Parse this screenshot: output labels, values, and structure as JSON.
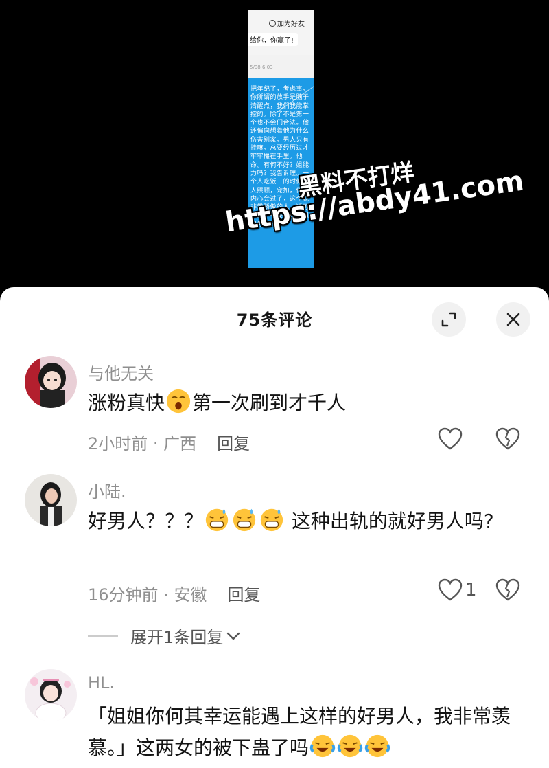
{
  "video": {
    "screenshot": {
      "add_friend": "加为好友",
      "message_top": "给你，你赢了!",
      "time": "5/08 6:03",
      "bubble_text": "把年纪了，考虑事。你所谓的放手是脑子清醒点，我们我能掌控的。除了不是第一个也不会们合法。他还偏向想着他为什么伤害别家。男人只有挂嘛。总要经历过才牢牢攥在手里。他命。有何不好？姐能力吗？我告诉理。一个人吃饭一的时候没人照顾，宠如，你的内心会过了，这个就非常骄傲的人，适可而止。不要追他。姐姐你何其"
    },
    "watermark": {
      "line1": "黑料不打烊",
      "line2": "https://abdy41.com"
    }
  },
  "header": {
    "title": "75条评论"
  },
  "comments": [
    {
      "author": "与他无关",
      "text_before": "涨粉真快",
      "text_after": "第一次刷到才千人",
      "time": "2小时前",
      "location": "广西",
      "reply_label": "回复",
      "likes": ""
    },
    {
      "author": "小陆.",
      "text_before": "好男人？？？",
      "text_after": " 这种出轨的就好男人吗?",
      "time": "16分钟前",
      "location": "安徽",
      "reply_label": "回复",
      "likes": "1",
      "expand_label": "展开1条回复"
    },
    {
      "author": "HL.",
      "text_before": "「姐姐你何其幸运能遇上这样的好男人，我非常羡慕。」这两女的被下蛊了吗",
      "text_after": ""
    }
  ],
  "separator": " · ",
  "colors": {
    "accent_blue": "#1d9be6",
    "text_primary": "#141414",
    "text_secondary": "#8f8f8f"
  }
}
